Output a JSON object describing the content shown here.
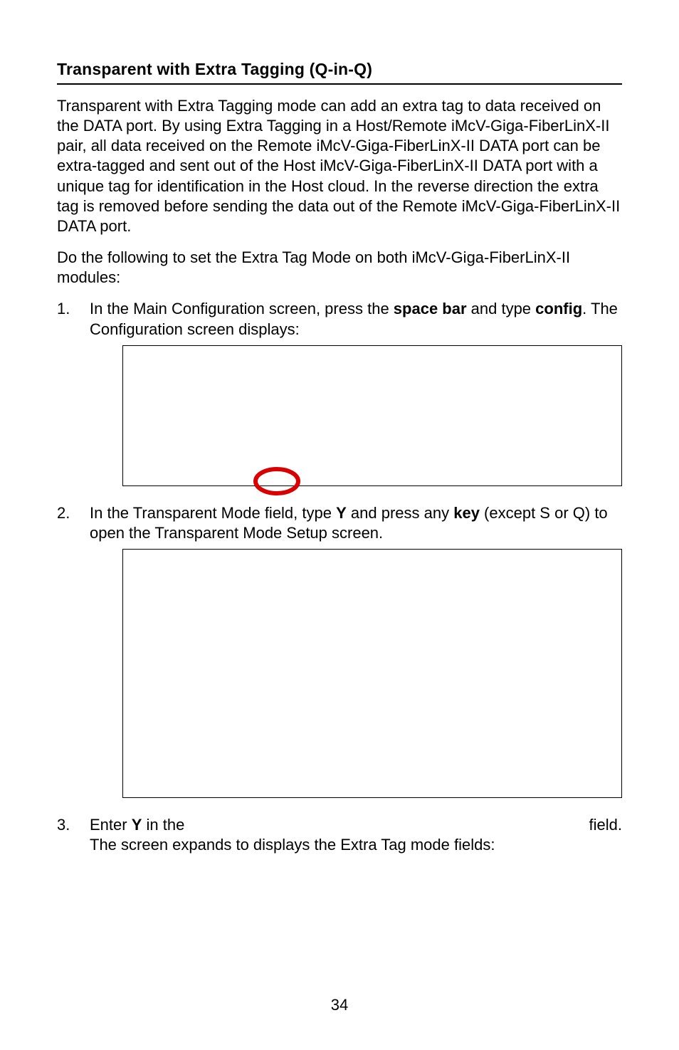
{
  "heading": "Transparent with Extra Tagging (Q-in-Q)",
  "para1": "Transparent with Extra Tagging mode can add an extra tag to data received on the DATA port.  By using Extra Tagging in a Host/Remote iMcV-Giga-FiberLinX-II pair, all data received on the Remote iMcV-Giga-FiberLinX-II DATA port can be extra-tagged and sent out of the Host iMcV-Giga-FiberLinX-II DATA port with a unique tag for identification in the Host cloud.  In the reverse direction the extra tag is removed before sending the data out of the Remote iMcV-Giga-FiberLinX-II DATA port.",
  "para2": "Do the following to set the Extra Tag Mode on both iMcV-Giga-FiberLinX-II modules:",
  "steps": {
    "s1": {
      "num": "1.",
      "pre": "In the Main Configuration screen, press the ",
      "b1": "space bar",
      "mid": " and type ",
      "b2": "config",
      "post": ".   The Configuration screen displays:"
    },
    "s2": {
      "num": "2.",
      "pre": "In the Transparent Mode field, type ",
      "b1": "Y",
      "mid": " and press any ",
      "b2": "key",
      "post": " (except S or Q) to open the Transparent Mode Setup screen."
    },
    "s3": {
      "num": "3.",
      "pre": "Enter ",
      "b1": "Y",
      "mid": " in the ",
      "post": "field. ",
      "line2": "The screen expands to displays the Extra Tag mode fields:"
    }
  },
  "page_number": "34"
}
